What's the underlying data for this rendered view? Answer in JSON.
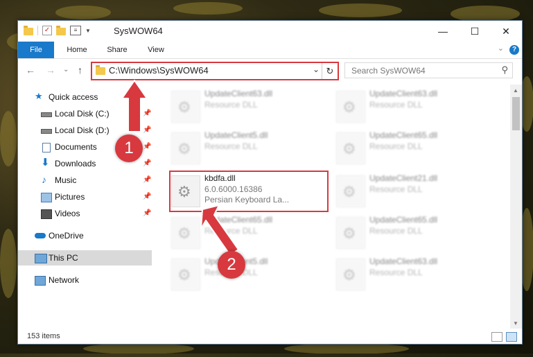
{
  "window": {
    "title": "SysWOW64",
    "minimize": "—",
    "maximize": "☐",
    "close": "✕"
  },
  "ribbon": {
    "tabs": [
      "File",
      "Home",
      "Share",
      "View"
    ],
    "help": "?",
    "collapse": "⌄"
  },
  "nav": {
    "back": "←",
    "forward": "→",
    "recent": "⌄",
    "up": "↑"
  },
  "address": {
    "path": "C:\\Windows\\SysWOW64",
    "dropdown": "⌄",
    "refresh": "↻"
  },
  "search": {
    "placeholder": "Search SysWOW64",
    "icon": "⚲"
  },
  "sidebar": {
    "items": [
      {
        "label": "Quick access",
        "icon": "star-icon"
      },
      {
        "label": "Local Disk (C:)",
        "icon": "drive-icon"
      },
      {
        "label": "Local Disk (D:)",
        "icon": "drive-icon"
      },
      {
        "label": "Documents",
        "icon": "documents-icon"
      },
      {
        "label": "Downloads",
        "icon": "download-icon"
      },
      {
        "label": "Music",
        "icon": "music-icon"
      },
      {
        "label": "Pictures",
        "icon": "pictures-icon"
      },
      {
        "label": "Videos",
        "icon": "videos-icon"
      },
      {
        "label": "OneDrive",
        "icon": "cloud-icon"
      },
      {
        "label": "This PC",
        "icon": "computer-icon"
      },
      {
        "label": "Network",
        "icon": "network-icon"
      }
    ],
    "pin": "📌"
  },
  "files": [
    {
      "name": "UpdateClient63.dll",
      "line1": "Resource DLL",
      "line2": ""
    },
    {
      "name": "UpdateClient63.dll",
      "line1": "Resource DLL",
      "line2": ""
    },
    {
      "name": "UpdateClient5.dll",
      "line1": "Resource DLL",
      "line2": ""
    },
    {
      "name": "UpdateClient65.dll",
      "line1": "Resource DLL",
      "line2": ""
    },
    {
      "name": "kbdfa.dll",
      "line1": "6.0.6000.16386",
      "line2": "Persian Keyboard La..."
    },
    {
      "name": "UpdateClient21.dll",
      "line1": "Resource DLL",
      "line2": ""
    },
    {
      "name": "UpdateClient65.dll",
      "line1": "Resource DLL",
      "line2": ""
    },
    {
      "name": "UpdateClient65.dll",
      "line1": "Resource DLL",
      "line2": ""
    },
    {
      "name": "UpdateClient5.dll",
      "line1": "Resource DLL",
      "line2": ""
    },
    {
      "name": "UpdateClient63.dll",
      "line1": "Resource DLL",
      "line2": ""
    }
  ],
  "status": {
    "count": "153 items"
  },
  "callouts": {
    "one": "1",
    "two": "2"
  },
  "colors": {
    "accent": "#1979ca",
    "highlight": "#d7393f"
  }
}
